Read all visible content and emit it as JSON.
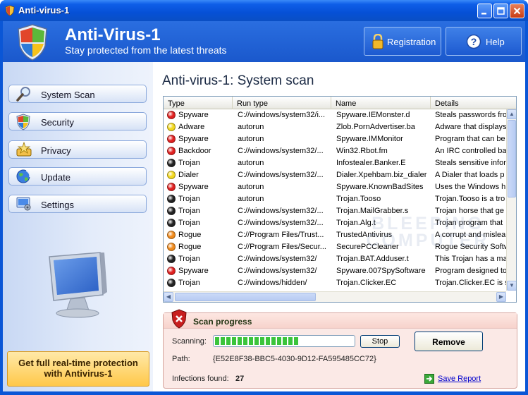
{
  "window": {
    "title": "Anti-virus-1"
  },
  "header": {
    "app_title": "Anti-Virus-1",
    "app_subtitle": "Stay protected from the latest threats",
    "registration_label": "Registration",
    "help_label": "Help"
  },
  "sidebar": {
    "items": [
      {
        "label": "System Scan",
        "icon": "magnifier-icon"
      },
      {
        "label": "Security",
        "icon": "shield-icon"
      },
      {
        "label": "Privacy",
        "icon": "privacy-icon"
      },
      {
        "label": "Update",
        "icon": "globe-icon"
      },
      {
        "label": "Settings",
        "icon": "settings-icon"
      }
    ],
    "promo_line1": "Get full real-time protection",
    "promo_line2": "with Antivirus-1"
  },
  "main": {
    "title": "Anti-virus-1: System scan",
    "columns": [
      "Type",
      "Run type",
      "Name",
      "Details"
    ],
    "rows": [
      {
        "type": "Spyware",
        "run": "C://windows/system32/i...",
        "name": "Spyware.IEMonster.d",
        "details": "Steals passwords fro",
        "dot": "#e02020"
      },
      {
        "type": "Adware",
        "run": "autorun",
        "name": "Zlob.PornAdvertiser.ba",
        "details": "Adware that displays",
        "dot": "#f2d81e"
      },
      {
        "type": "Spyware",
        "run": "autorun",
        "name": "Spyware.IMMonitor",
        "details": "Program that can be",
        "dot": "#e02020"
      },
      {
        "type": "Backdoor",
        "run": "C://windows/system32/...",
        "name": "Win32.Rbot.fm",
        "details": "An IRC controlled ba",
        "dot": "#e02020"
      },
      {
        "type": "Trojan",
        "run": "autorun",
        "name": "Infostealer.Banker.E",
        "details": "Steals sensitive infor",
        "dot": "#222222"
      },
      {
        "type": "Dialer",
        "run": "C://windows/system32/...",
        "name": "Dialer.Xpehbam.biz_dialer",
        "details": "A Dialer that loads p",
        "dot": "#f2d81e"
      },
      {
        "type": "Spyware",
        "run": "autorun",
        "name": "Spyware.KnownBadSites",
        "details": "Uses the Windows h",
        "dot": "#e02020"
      },
      {
        "type": "Trojan",
        "run": "autorun",
        "name": "Trojan.Tooso",
        "details": "Trojan.Tooso is a tro",
        "dot": "#222222"
      },
      {
        "type": "Trojan",
        "run": "C://windows/system32/...",
        "name": "Trojan.MailGrabber.s",
        "details": "Trojan horse that ge",
        "dot": "#222222"
      },
      {
        "type": "Trojan",
        "run": "C://windows/system32/...",
        "name": "Trojan.Alg.t",
        "details": "Trojan program that",
        "dot": "#222222"
      },
      {
        "type": "Rogue",
        "run": "C://Program Files/Trust...",
        "name": "TrustedAntivirus",
        "details": "A corrupt and mislea",
        "dot": "#f08a1c"
      },
      {
        "type": "Rogue",
        "run": "C://Program Files/Secur...",
        "name": "SecurePCCleaner",
        "details": "Rogue Security Softw",
        "dot": "#f08a1c"
      },
      {
        "type": "Trojan",
        "run": "C://windows/system32/",
        "name": "Trojan.BAT.Adduser.t",
        "details": "This Trojan has a ma",
        "dot": "#222222"
      },
      {
        "type": "Spyware",
        "run": "C://windows/system32/",
        "name": "Spyware.007SpySoftware",
        "details": "Program designed to",
        "dot": "#e02020"
      },
      {
        "type": "Trojan",
        "run": "C://windows/hidden/",
        "name": "Trojan.Clicker.EC",
        "details": "Trojan.Clicker.EC is s",
        "dot": "#222222"
      }
    ],
    "watermark_line1": "BLEEPING",
    "watermark_line2": "COMPUTER"
  },
  "scan": {
    "heading": "Scan progress",
    "scanning_label": "Scanning:",
    "progress_fraction": 0.6,
    "stop_label": "Stop",
    "remove_label": "Remove",
    "path_label": "Path:",
    "path_value": "{E52E8F38-BBC5-4030-9D12-FA595485CC72}",
    "infections_label": "Infections found:",
    "infections_count": "27",
    "save_report_label": "Save Report"
  }
}
